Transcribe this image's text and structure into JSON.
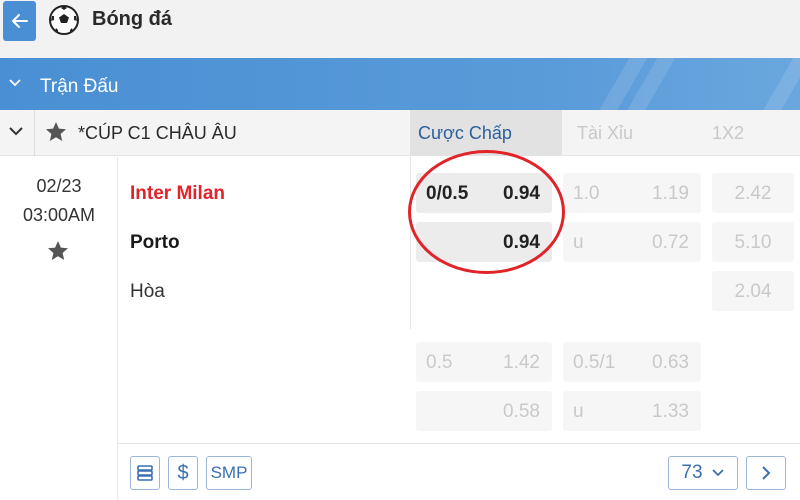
{
  "header": {
    "title": "Bóng đá",
    "back_icon": "arrow-left-icon",
    "sport_icon": "soccer-ball-icon"
  },
  "section": {
    "title": "Trận Đấu"
  },
  "league": {
    "name": "*CÚP C1 CHÂU ÂU",
    "tabs": [
      "Cược Chấp",
      "Tài Xỉu",
      "1X2"
    ],
    "active_tab": "Cược Chấp"
  },
  "match": {
    "date": "02/23",
    "time": "03:00AM",
    "home": "Inter Milan",
    "away": "Porto",
    "draw": "Hòa"
  },
  "odds": {
    "main": {
      "handicap": {
        "line": "0/0.5",
        "home": "0.94",
        "away": "0.94"
      },
      "over_under": {
        "line": "1.0",
        "over": "1.19",
        "under_label": "u",
        "under": "0.72"
      },
      "one_x_two": {
        "home": "2.42",
        "away": "5.10",
        "draw": "2.04"
      }
    },
    "alt": {
      "handicap": {
        "line": "0.5",
        "home": "1.42",
        "away": "0.58"
      },
      "over_under": {
        "line": "0.5/1",
        "over": "0.63",
        "under_label": "u",
        "under": "1.33"
      }
    }
  },
  "footer": {
    "smp_label": "SMP",
    "dollar_label": "$",
    "market_count": "73"
  },
  "colors": {
    "accent": "#4a8fd4",
    "home_team": "#e0242a",
    "highlight_ring": "#e0242a"
  }
}
